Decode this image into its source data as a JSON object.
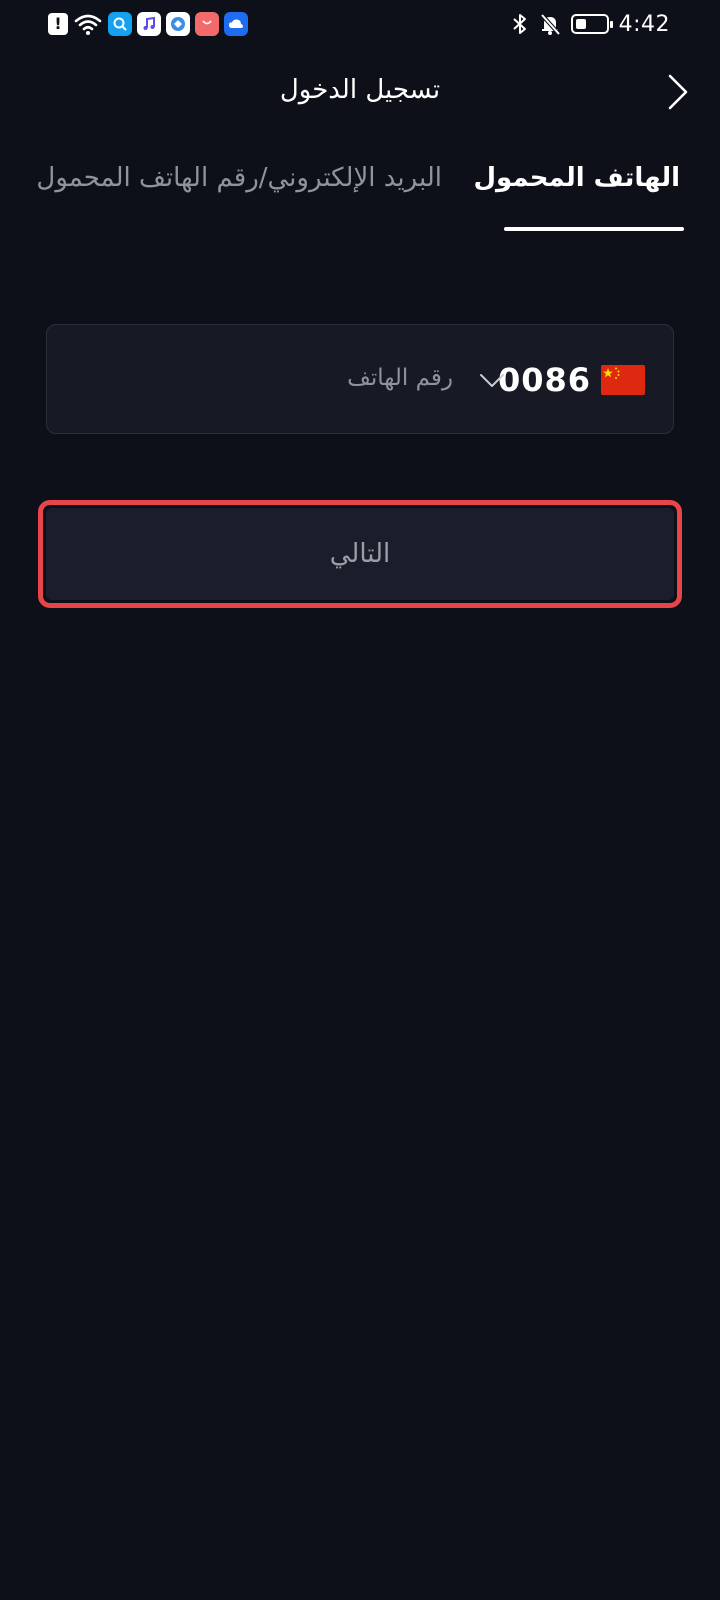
{
  "status_bar": {
    "time": "4:42",
    "battery_level": 0.35,
    "left_icons": [
      "alert-icon",
      "wifi-icon",
      "search-app-icon",
      "music-app-icon",
      "browser-app-icon",
      "store-app-icon",
      "weather-app-icon"
    ],
    "right_icons": [
      "bluetooth-icon",
      "mute-bell-icon",
      "battery-icon"
    ]
  },
  "header": {
    "title": "تسجيل الدخول",
    "back_icon": "chevron-right-icon"
  },
  "tabs": [
    {
      "label": "الهاتف المحمول",
      "active": true
    },
    {
      "label": "البريد الإلكتروني/رقم الهاتف المحمول",
      "active": false
    }
  ],
  "phone_field": {
    "country_flag": "china-flag-icon",
    "country_code": "0086",
    "dropdown_icon": "chevron-down-icon",
    "placeholder": "رقم الهاتف",
    "value": ""
  },
  "next_button": {
    "label": "التالي"
  },
  "colors": {
    "background": "#0d1018",
    "field_background": "#171a24",
    "button_background": "#1b1e2a",
    "highlight": "#e8454a",
    "muted_text": "#8f939c"
  }
}
